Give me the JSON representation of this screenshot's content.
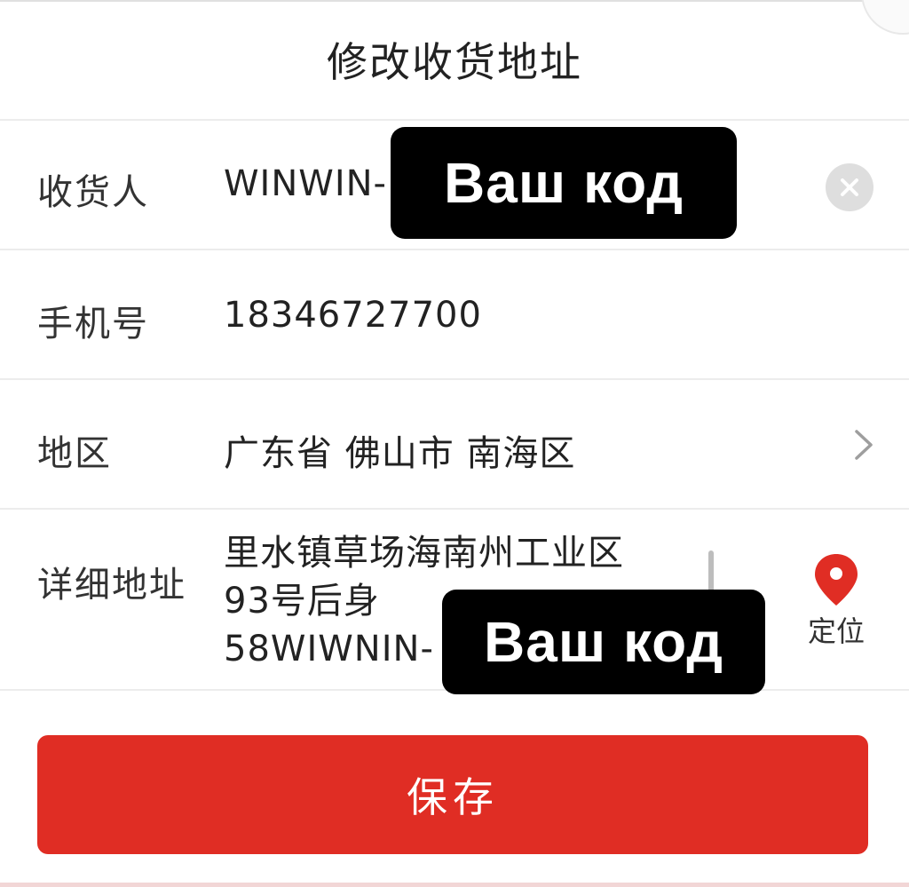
{
  "header": {
    "title": "修改收货地址"
  },
  "form": {
    "receiver": {
      "label": "收货人",
      "value": "WINWIN-"
    },
    "phone": {
      "label": "手机号",
      "value": "18346727700"
    },
    "region": {
      "label": "地区",
      "value": "广东省 佛山市 南海区"
    },
    "address": {
      "label": "详细地址",
      "lines": [
        "里水镇草场海南州工业区",
        "93号后身",
        "58WIWNIN-"
      ]
    }
  },
  "overlays": {
    "code_badge_1": "Ваш код",
    "code_badge_2": "Ваш код"
  },
  "locate": {
    "label": "定位"
  },
  "save_label": "保存",
  "icons": {
    "clear": "close-circle-icon",
    "chevron": "chevron-right-icon",
    "locate": "map-pin-icon"
  },
  "colors": {
    "primary": "#e02d24",
    "badge_bg": "#000000",
    "divider": "#ececec"
  }
}
